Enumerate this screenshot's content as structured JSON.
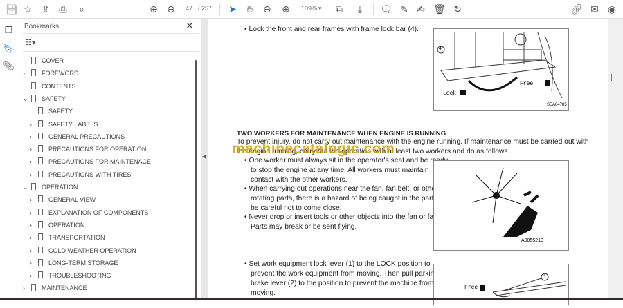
{
  "toolbar": {
    "current_page": "47",
    "total_pages": "/ 257",
    "zoom": "109%"
  },
  "bookmarks": {
    "title": "Bookmarks",
    "items": [
      {
        "label": "COVER",
        "level": 0,
        "chev": ""
      },
      {
        "label": "FOREWORD",
        "level": 0,
        "chev": "›"
      },
      {
        "label": "CONTENTS",
        "level": 0,
        "chev": ""
      },
      {
        "label": "SAFETY",
        "level": 0,
        "chev": "⌄"
      },
      {
        "label": "SAFETY",
        "level": 1,
        "chev": ""
      },
      {
        "label": "SAFETY LABELS",
        "level": 1,
        "chev": "›"
      },
      {
        "label": "GENERAL PRECAUTIONS",
        "level": 1,
        "chev": "›"
      },
      {
        "label": "PRECAUTIONS FOR OPERATION",
        "level": 1,
        "chev": "›"
      },
      {
        "label": "PRECAUTIONS FOR MAINTENACE",
        "level": 1,
        "chev": "›"
      },
      {
        "label": "PRECAUTIONS WITH TIRES",
        "level": 1,
        "chev": "›"
      },
      {
        "label": "OPERATION",
        "level": 0,
        "chev": "⌄"
      },
      {
        "label": "GENERAL VIEW",
        "level": 1,
        "chev": "›"
      },
      {
        "label": "EXPLANATION OF COMPONENTS",
        "level": 1,
        "chev": "›"
      },
      {
        "label": "OPERATION",
        "level": 1,
        "chev": "›"
      },
      {
        "label": "TRANSPORTATION",
        "level": 1,
        "chev": "›"
      },
      {
        "label": "COLD WEATHER OPERATION",
        "level": 1,
        "chev": "›"
      },
      {
        "label": "LONG-TERM STORAGE",
        "level": 1,
        "chev": "›"
      },
      {
        "label": "TROUBLESHOOTING",
        "level": 1,
        "chev": "›"
      },
      {
        "label": "MAINTENANCE",
        "level": 0,
        "chev": "›"
      }
    ]
  },
  "doc": {
    "bullet1": "• Lock the front and rear frames with frame lock bar (4).",
    "fig1": {
      "lock": "Lock",
      "free": "Free",
      "num": "4",
      "code": "SEA04785"
    },
    "heading": "TWO WORKERS FOR MAINTENANCE WHEN ENGINE IS RUNNING",
    "para1": "To prevent injury, do not carry out maintenance with the engine running.  If maintenance must be carried out with",
    "para2": "the engine running, carry out the operation with at least two workers and do as follows.",
    "b2": [
      "• One worker must always sit in the operator's seat and be ready",
      "to stop the engine at any time.  All workers must maintain",
      "contact with the other workers."
    ],
    "b3": [
      "• When carrying out operations near the fan, fan belt, or other",
      "rotating parts, there is a hazard of being caught in the parts, so",
      "be careful not to come close."
    ],
    "b4": [
      "• Never drop or insert tools or other objects into the fan or fan belt.",
      "Parts may break or be sent flying."
    ],
    "fig2": {
      "code": "A0055210"
    },
    "b5": [
      "• Set work equipment lock lever (1) to the LOCK position to",
      "prevent the work equipment from moving. Then pull parking",
      "brake lever (2) to the position to prevent the machine from",
      "moving."
    ],
    "fig3": {
      "free": "Free",
      "num": "1"
    },
    "watermark": "machinecatalogic.com"
  }
}
